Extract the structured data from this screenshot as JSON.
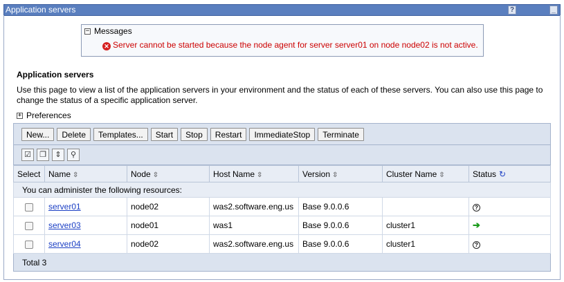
{
  "portlet": {
    "title": "Application servers",
    "help_glyph": "?",
    "minimize_glyph": "_"
  },
  "messages": {
    "header": "Messages",
    "error": "Server cannot be started because the node agent for server server01 on node node02 is not active."
  },
  "section": {
    "title": "Application servers",
    "description": "Use this page to view a list of the application servers in your environment and the status of each of these servers. You can also use this page to change the status of a specific application server."
  },
  "preferences_label": "Preferences",
  "toolbar": {
    "buttons": [
      "New...",
      "Delete",
      "Templates...",
      "Start",
      "Stop",
      "Restart",
      "ImmediateStop",
      "Terminate"
    ],
    "icons": [
      "select-all-icon",
      "deselect-all-icon",
      "show-filter-icon",
      "clear-filter-icon"
    ]
  },
  "table": {
    "headers": [
      "Select",
      "Name",
      "Node",
      "Host Name",
      "Version",
      "Cluster Name",
      "Status"
    ],
    "info_row": "You can administer the following resources:",
    "rows": [
      {
        "name": "server01",
        "node": "node02",
        "host": "was2.software.eng.us",
        "version": "Base 9.0.0.6",
        "cluster": "",
        "status": "unknown"
      },
      {
        "name": "server03",
        "node": "node01",
        "host": "was1",
        "version": "Base 9.0.0.6",
        "cluster": "cluster1",
        "status": "started"
      },
      {
        "name": "server04",
        "node": "node02",
        "host": "was2.software.eng.us",
        "version": "Base 9.0.0.6",
        "cluster": "cluster1",
        "status": "unknown"
      }
    ],
    "total": "Total 3"
  },
  "colors": {
    "titlebar": "#5a7fbf",
    "error_text": "#cc0000",
    "link": "#1a3ec4",
    "started": "#1a9a1a"
  }
}
